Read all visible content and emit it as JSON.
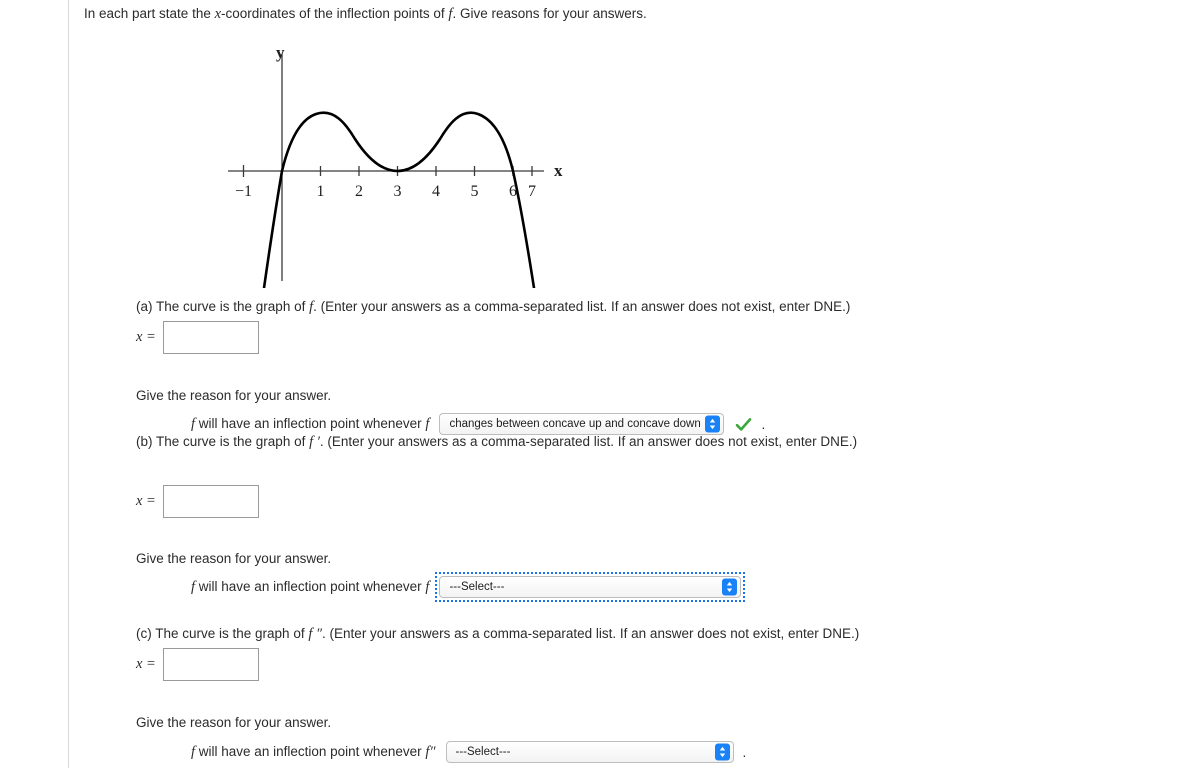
{
  "prompt": {
    "before_x": "In each part state the ",
    "x": "x",
    "after_x": "-coordinates of the inflection points of ",
    "f": "f",
    "tail": ". Give reasons for your answers."
  },
  "graph": {
    "y_axis_label": "y",
    "x_axis_label": "x",
    "x_tick_labels": [
      "−1",
      "1",
      "2",
      "3",
      "4",
      "5",
      "6",
      "7"
    ],
    "curve_color": "#000000",
    "axis_color": "#3a3a3a"
  },
  "chart_data": {
    "type": "line",
    "title": "",
    "xlabel": "x",
    "ylabel": "y",
    "xlim": [
      -1.3,
      7.4
    ],
    "ylim": [
      -2.6,
      1.45
    ],
    "grid": false,
    "legend": null,
    "xticks": [
      -1,
      1,
      2,
      3,
      4,
      5,
      6,
      7
    ],
    "xticklabels": [
      "−1",
      "1",
      "2",
      "3",
      "4",
      "5",
      "6",
      "7"
    ],
    "yticks": [],
    "description": "Graph of a quartic-like curve with x-intercepts at x = 0 and x = 6 (double root at 3 touching axis), local maxima near x = 0.9 and x = 5.1, local minimum touching the x-axis at x = 3.",
    "features": {
      "x_intercepts": [
        0,
        3,
        6
      ],
      "local_maxima_x": [
        0.9,
        5.1
      ],
      "local_minima_x": [
        3
      ],
      "inflection_points_x": [
        2,
        4
      ]
    },
    "series": [
      {
        "name": "f",
        "x": [
          -0.45,
          -0.35,
          -0.25,
          -0.15,
          -0.05,
          0.0,
          0.1,
          0.2,
          0.3,
          0.45,
          0.6,
          0.75,
          0.9,
          1.05,
          1.2,
          1.4,
          1.6,
          1.8,
          2.0,
          2.2,
          2.4,
          2.6,
          2.8,
          3.0,
          3.2,
          3.4,
          3.6,
          3.8,
          4.0,
          4.2,
          4.4,
          4.6,
          4.8,
          5.0,
          5.1,
          5.25,
          5.4,
          5.6,
          5.8,
          6.0,
          6.15,
          6.3,
          6.45
        ],
        "y": [
          -2.6,
          -2.0,
          -1.4,
          -0.82,
          -0.26,
          0.0,
          0.34,
          0.6,
          0.79,
          0.97,
          1.05,
          1.08,
          1.09,
          1.05,
          0.98,
          0.84,
          0.67,
          0.48,
          0.32,
          0.18,
          0.08,
          0.02,
          0.0,
          0.0,
          0.02,
          0.08,
          0.18,
          0.32,
          0.48,
          0.65,
          0.82,
          0.96,
          1.05,
          1.09,
          1.09,
          1.04,
          0.93,
          0.7,
          0.38,
          0.0,
          -0.5,
          -1.2,
          -2.1
        ]
      }
    ]
  },
  "parts": [
    {
      "id": "a",
      "statement_prefix": "(a) The curve is the graph of ",
      "function_label": "f",
      "statement_suffix": ". (Enter your answers as a comma-separated list. If an answer does not exist, enter DNE.)",
      "answer_label": "x =",
      "answer_value": "",
      "reason_label": "Give the reason for your answer.",
      "reason_prefix": "f will have an inflection point whenever ",
      "reason_function_label": "f",
      "select_value": "changes between concave up and concave down",
      "select_focused": false,
      "has_check": true,
      "trailing_period": "."
    },
    {
      "id": "b",
      "statement_prefix": "(b) The curve is the graph of ",
      "function_label": "f ′",
      "statement_suffix": ". (Enter your answers as a comma-separated list. If an answer does not exist, enter DNE.)",
      "answer_label": "x =",
      "answer_value": "",
      "reason_label": "Give the reason for your answer.",
      "reason_prefix": "f will have an inflection point whenever ",
      "reason_function_label": "f",
      "select_value": "---Select---",
      "select_focused": true,
      "has_check": false,
      "trailing_period": ""
    },
    {
      "id": "c",
      "statement_prefix": "(c) The curve is the graph of ",
      "function_label": "f ″",
      "statement_suffix": ". (Enter your answers as a comma-separated list. If an answer does not exist, enter DNE.)",
      "answer_label": "x =",
      "answer_value": "",
      "reason_label": "Give the reason for your answer.",
      "reason_prefix": "f will have an inflection point whenever ",
      "reason_function_label": "f ″",
      "select_value": "---Select---",
      "select_focused": false,
      "has_check": false,
      "trailing_period": "."
    }
  ],
  "colors": {
    "accent_blue": "#1a82f7",
    "focus_blue": "#1a73e8",
    "check_green": "#3aa93a",
    "text": "#2b2b2b",
    "border": "#9a9a9a"
  }
}
